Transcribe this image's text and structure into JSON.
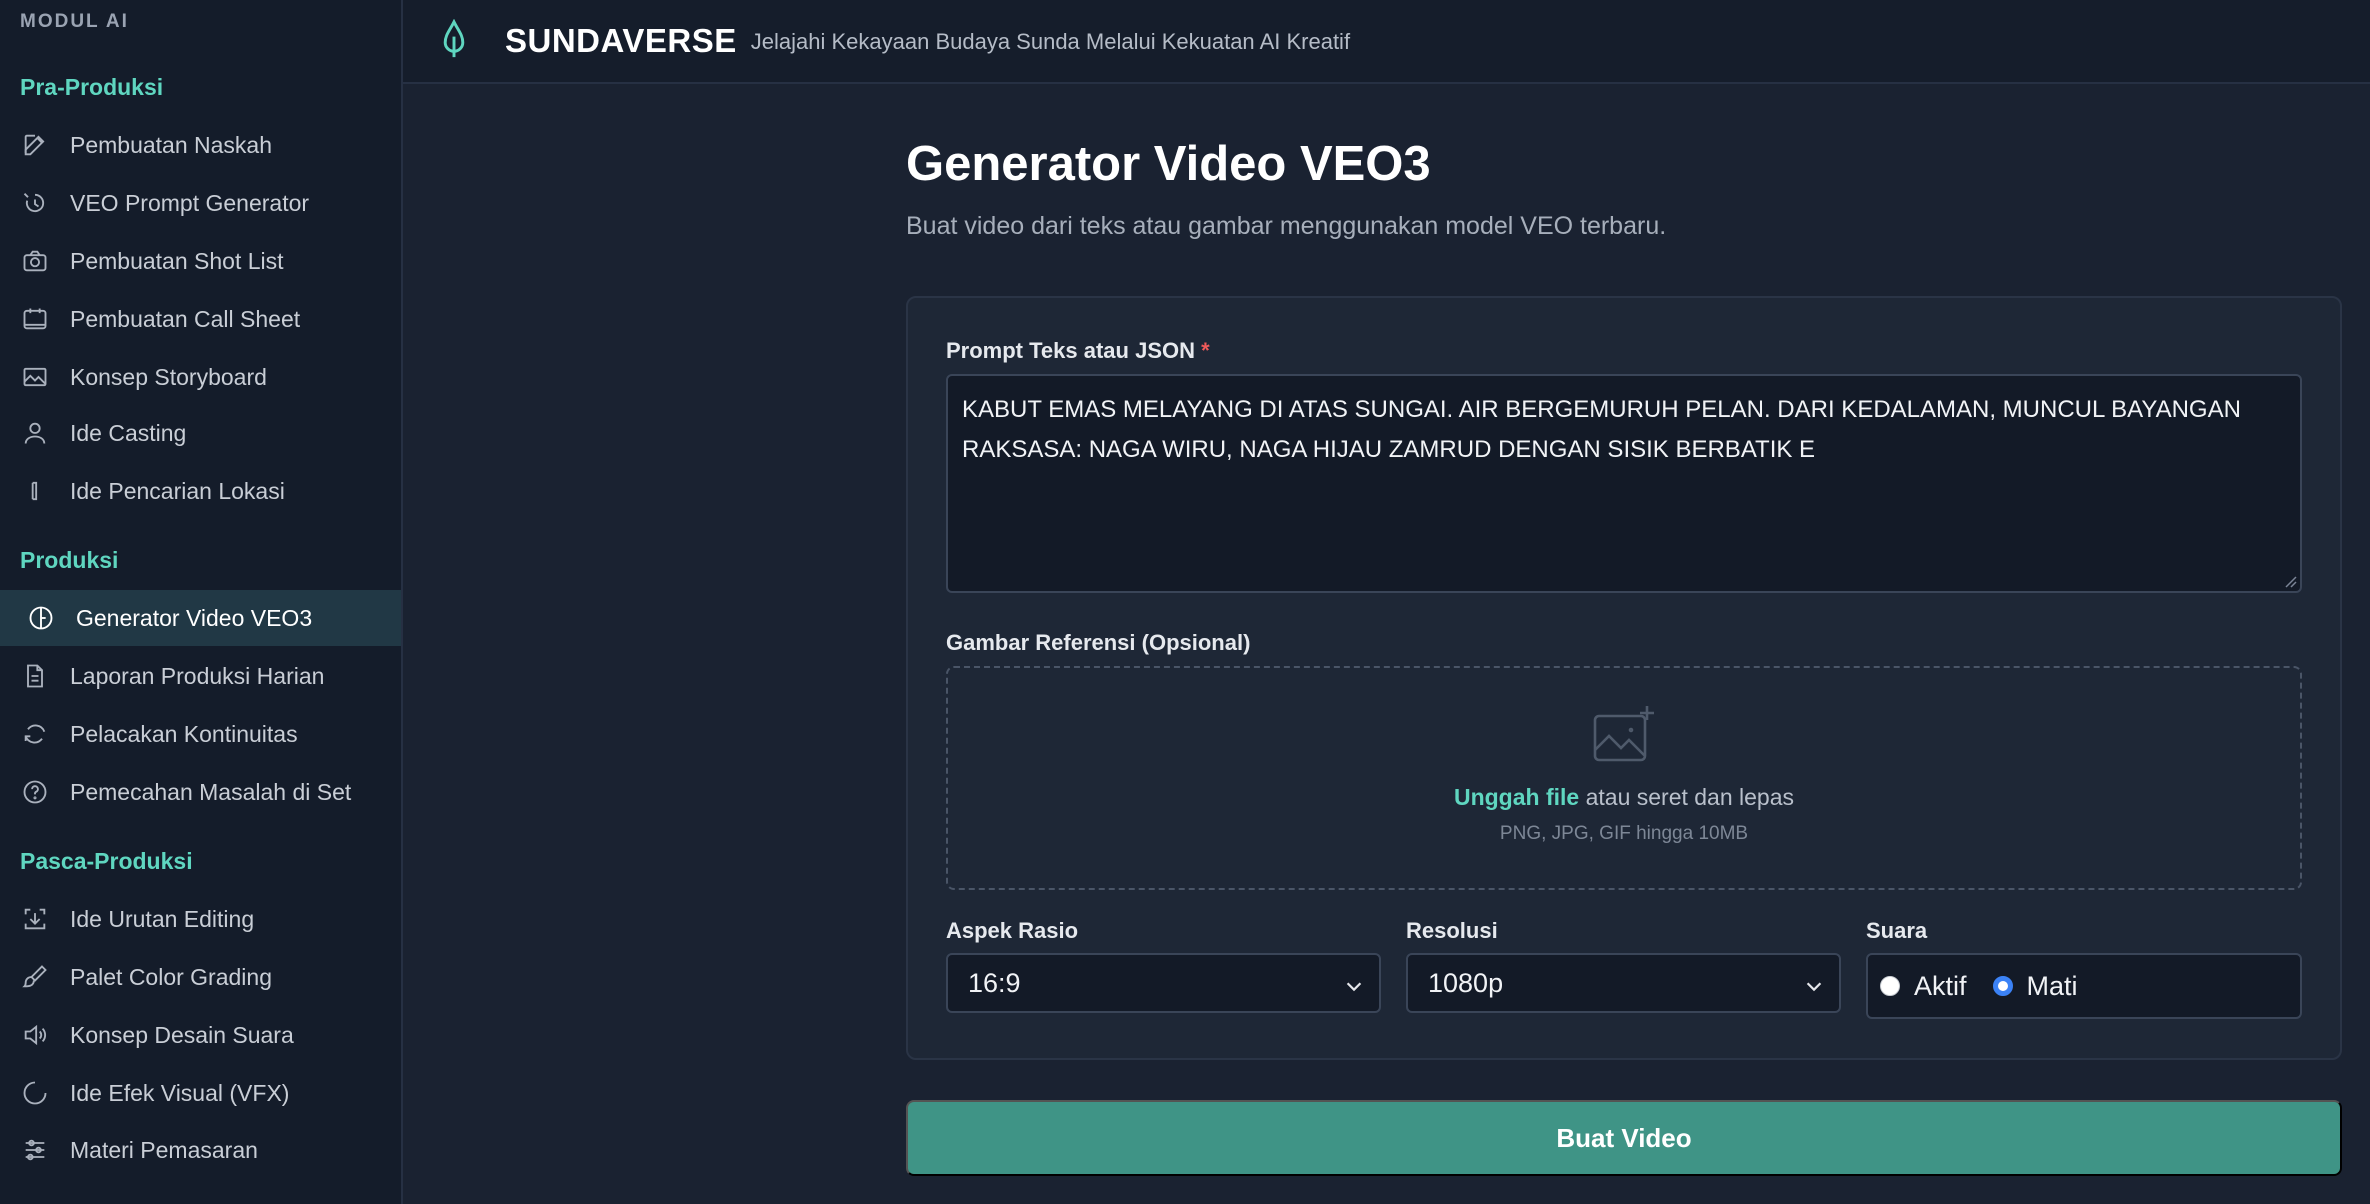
{
  "sidebar": {
    "header": "MODUL AI",
    "sections": [
      {
        "label": "Pra-Produksi",
        "items": [
          {
            "label": "Pembuatan Naskah",
            "icon": "pencil-square-icon"
          },
          {
            "label": "VEO Prompt Generator",
            "icon": "wand-sparkle-icon"
          },
          {
            "label": "Pembuatan Shot List",
            "icon": "camera-icon"
          },
          {
            "label": "Pembuatan Call Sheet",
            "icon": "calendar-icon"
          },
          {
            "label": "Konsep Storyboard",
            "icon": "image-icon"
          },
          {
            "label": "Ide Casting",
            "icon": "user-icon"
          },
          {
            "label": "Ide Pencarian Lokasi",
            "icon": "map-pin-icon"
          }
        ]
      },
      {
        "label": "Produksi",
        "items": [
          {
            "label": "Generator Video VEO3",
            "icon": "clock-half-icon",
            "active": true
          },
          {
            "label": "Laporan Produksi Harian",
            "icon": "document-icon"
          },
          {
            "label": "Pelacakan Kontinuitas",
            "icon": "refresh-arrow-icon"
          },
          {
            "label": "Pemecahan Masalah di Set",
            "icon": "question-circle-icon"
          }
        ]
      },
      {
        "label": "Pasca-Produksi",
        "items": [
          {
            "label": "Ide Urutan Editing",
            "icon": "download-tray-icon"
          },
          {
            "label": "Palet Color Grading",
            "icon": "brush-icon"
          },
          {
            "label": "Konsep Desain Suara",
            "icon": "speaker-icon"
          },
          {
            "label": "Ide Efek Visual (VFX)",
            "icon": "circle-icon"
          },
          {
            "label": "Materi Pemasaran",
            "icon": "sliders-icon"
          }
        ]
      }
    ]
  },
  "topbar": {
    "brand": "SUNDAVERSE",
    "tagline": "Jelajahi Kekayaan Budaya Sunda Melalui Kekuatan AI Kreatif",
    "logo_icon": "flame-drop-icon"
  },
  "main": {
    "title": "Generator Video VEO3",
    "subtitle": "Buat video dari teks atau gambar menggunakan model VEO terbaru.",
    "prompt": {
      "label": "Prompt Teks atau JSON",
      "required_mark": "*",
      "value": "KABUT EMAS MELAYANG DI ATAS SUNGAI. AIR BERGEMURUH PELAN. DARI KEDALAMAN, MUNCUL BAYANGAN RAKSASA: NAGA WIRU, NAGA HIJAU ZAMRUD DENGAN SISIK BERBATIK E"
    },
    "reference": {
      "label": "Gambar Referensi (Opsional)",
      "upload_link": "Unggah file",
      "upload_rest": " atau seret dan lepas",
      "hint": "PNG, JPG, GIF hingga 10MB"
    },
    "aspect": {
      "label": "Aspek Rasio",
      "value": "16:9"
    },
    "resolution": {
      "label": "Resolusi",
      "value": "1080p"
    },
    "sound": {
      "label": "Suara",
      "options": [
        {
          "label": "Aktif",
          "selected": false
        },
        {
          "label": "Mati",
          "selected": true
        }
      ]
    },
    "submit_label": "Buat Video"
  },
  "colors": {
    "accent": "#5fd6c0",
    "button": "#3f9486",
    "background": "#1a2231",
    "sidebar": "#141c2a"
  }
}
